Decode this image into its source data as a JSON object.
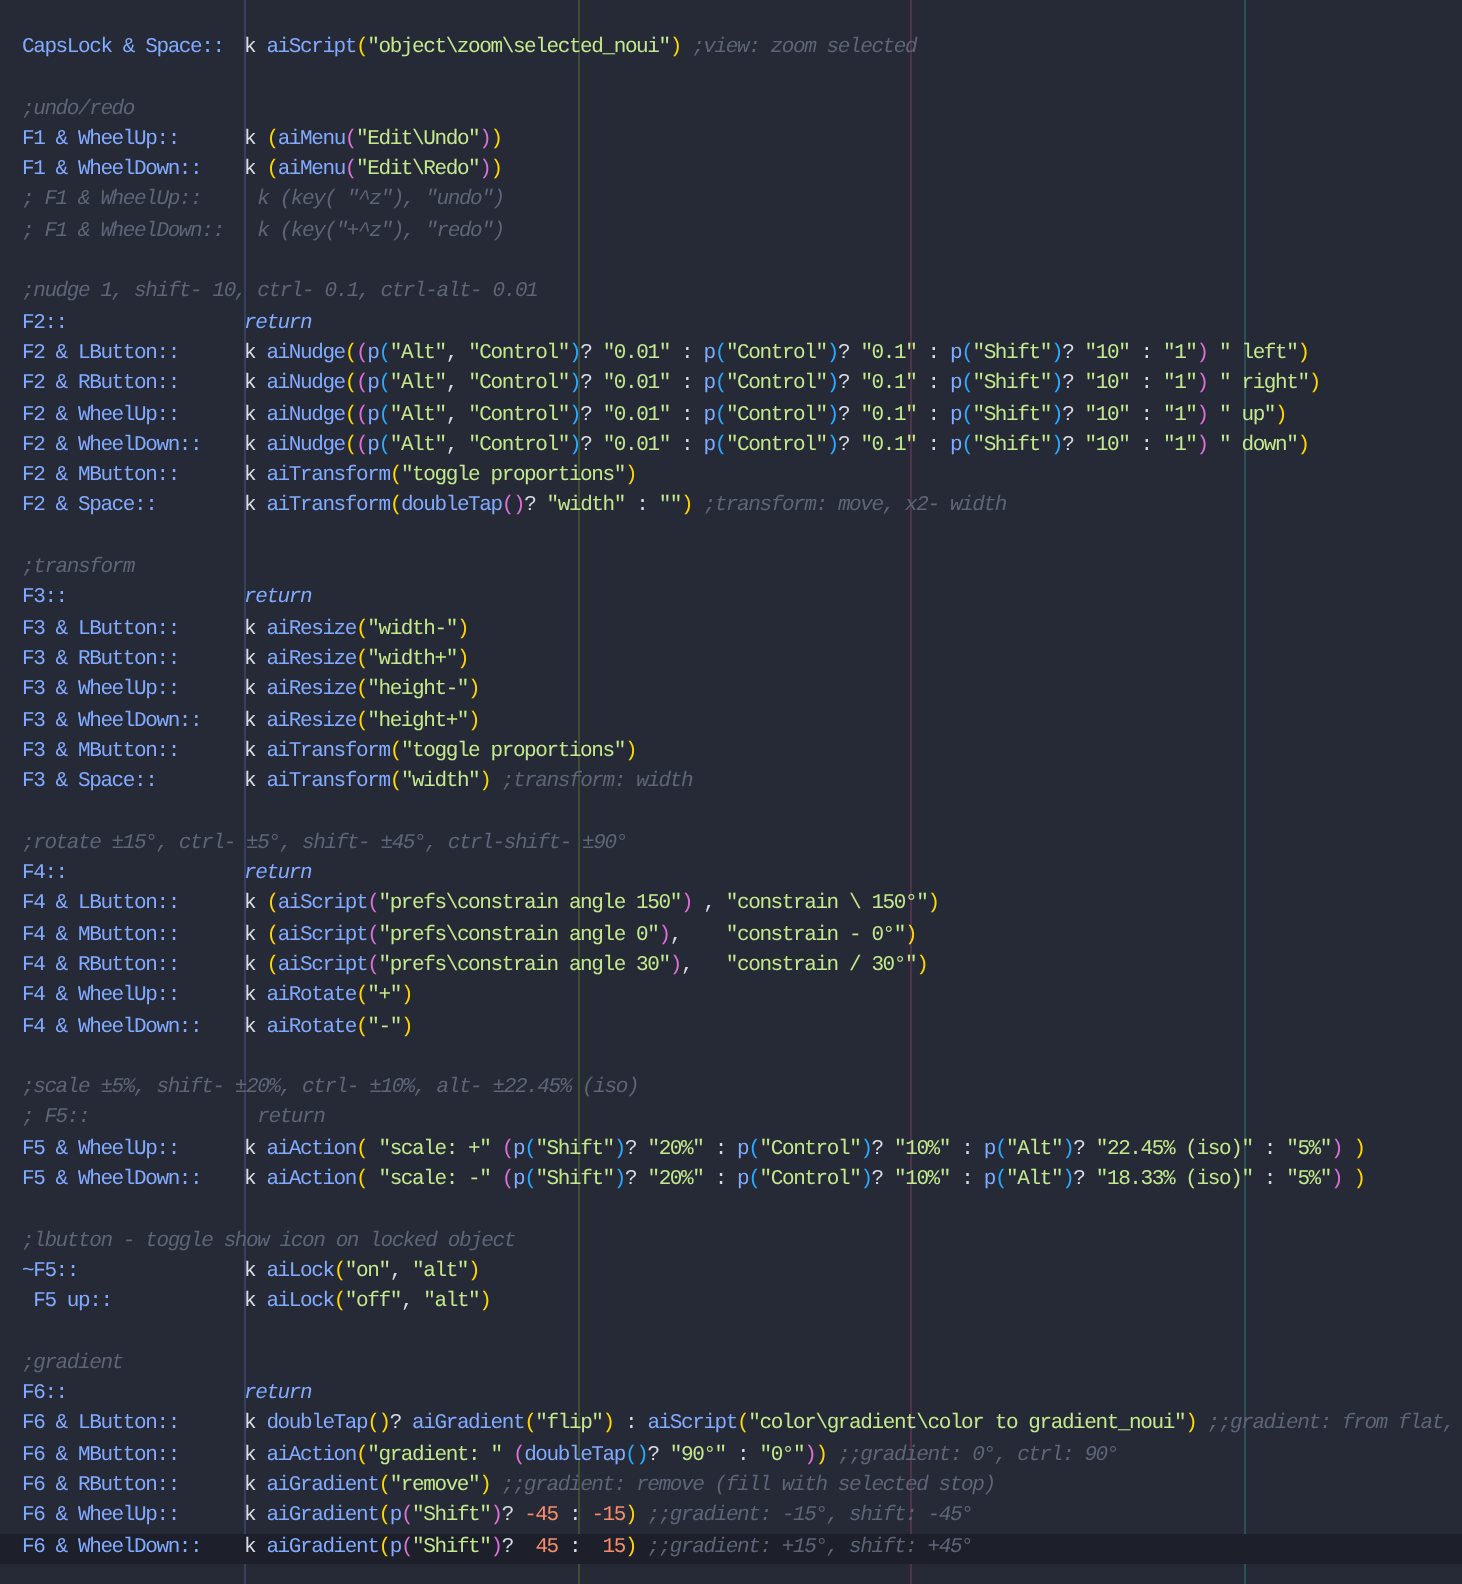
{
  "editor": {
    "lines": [
      {
        "kind": "binding",
        "hotkey": "CapsLock & Space::",
        "code": "k aiScript(\"object\\zoom\\selected_noui\") ;view: zoom selected",
        "current": false
      },
      {
        "kind": "blank",
        "current": false
      },
      {
        "kind": "comment",
        "text": ";undo/redo",
        "current": false
      },
      {
        "kind": "binding",
        "hotkey": "F1 & WheelUp::",
        "code": "k (aiMenu(\"Edit\\Undo\"))",
        "current": false
      },
      {
        "kind": "binding",
        "hotkey": "F1 & WheelDown::",
        "code": "k (aiMenu(\"Edit\\Redo\"))",
        "current": false
      },
      {
        "kind": "comment",
        "text": "; F1 & WheelUp::     k (key( \"^z\"), \"undo\")",
        "current": false
      },
      {
        "kind": "comment",
        "text": "; F1 & WheelDown::   k (key(\"+^z\"), \"redo\")",
        "current": false
      },
      {
        "kind": "blank",
        "current": false
      },
      {
        "kind": "comment",
        "text": ";nudge 1, shift- 10, ctrl- 0.1, ctrl-alt- 0.01",
        "current": false
      },
      {
        "kind": "block",
        "hotkey": "F2::",
        "code": "return",
        "current": false
      },
      {
        "kind": "binding",
        "hotkey": "F2 & LButton::",
        "code": "k aiNudge((p(\"Alt\", \"Control\")? \"0.01\" : p(\"Control\")? \"0.1\" : p(\"Shift\")? \"10\" : \"1\") \" left\")",
        "current": false
      },
      {
        "kind": "binding",
        "hotkey": "F2 & RButton::",
        "code": "k aiNudge((p(\"Alt\", \"Control\")? \"0.01\" : p(\"Control\")? \"0.1\" : p(\"Shift\")? \"10\" : \"1\") \" right\")",
        "current": false
      },
      {
        "kind": "binding",
        "hotkey": "F2 & WheelUp::",
        "code": "k aiNudge((p(\"Alt\", \"Control\")? \"0.01\" : p(\"Control\")? \"0.1\" : p(\"Shift\")? \"10\" : \"1\") \" up\")",
        "current": false
      },
      {
        "kind": "binding",
        "hotkey": "F2 & WheelDown::",
        "code": "k aiNudge((p(\"Alt\", \"Control\")? \"0.01\" : p(\"Control\")? \"0.1\" : p(\"Shift\")? \"10\" : \"1\") \" down\")",
        "current": false
      },
      {
        "kind": "binding",
        "hotkey": "F2 & MButton::",
        "code": "k aiTransform(\"toggle proportions\")",
        "current": false
      },
      {
        "kind": "binding",
        "hotkey": "F2 & Space::",
        "code": "k aiTransform(doubleTap()? \"width\" : \"\") ;transform: move, x2- width",
        "current": false
      },
      {
        "kind": "blank",
        "current": false
      },
      {
        "kind": "comment",
        "text": ";transform",
        "current": false
      },
      {
        "kind": "block",
        "hotkey": "F3::",
        "code": "return",
        "current": false
      },
      {
        "kind": "binding",
        "hotkey": "F3 & LButton::",
        "code": "k aiResize(\"width-\")",
        "current": false
      },
      {
        "kind": "binding",
        "hotkey": "F3 & RButton::",
        "code": "k aiResize(\"width+\")",
        "current": false
      },
      {
        "kind": "binding",
        "hotkey": "F3 & WheelUp::",
        "code": "k aiResize(\"height-\")",
        "current": false
      },
      {
        "kind": "binding",
        "hotkey": "F3 & WheelDown::",
        "code": "k aiResize(\"height+\")",
        "current": false
      },
      {
        "kind": "binding",
        "hotkey": "F3 & MButton::",
        "code": "k aiTransform(\"toggle proportions\")",
        "current": false
      },
      {
        "kind": "binding",
        "hotkey": "F3 & Space::",
        "code": "k aiTransform(\"width\") ;transform: width",
        "current": false
      },
      {
        "kind": "blank",
        "current": false
      },
      {
        "kind": "comment",
        "text": ";rotate ±15°, ctrl- ±5°, shift- ±45°, ctrl-shift- ±90°",
        "current": false
      },
      {
        "kind": "block",
        "hotkey": "F4::",
        "code": "return",
        "current": false
      },
      {
        "kind": "binding",
        "hotkey": "F4 & LButton::",
        "code": "k (aiScript(\"prefs\\constrain angle 150\") , \"constrain \\ 150°\")",
        "current": false
      },
      {
        "kind": "binding",
        "hotkey": "F4 & MButton::",
        "code": "k (aiScript(\"prefs\\constrain angle 0\"),    \"constrain - 0°\")",
        "current": false
      },
      {
        "kind": "binding",
        "hotkey": "F4 & RButton::",
        "code": "k (aiScript(\"prefs\\constrain angle 30\"),   \"constrain / 30°\")",
        "current": false
      },
      {
        "kind": "binding",
        "hotkey": "F4 & WheelUp::",
        "code": "k aiRotate(\"+\")",
        "current": false
      },
      {
        "kind": "binding",
        "hotkey": "F4 & WheelDown::",
        "code": "k aiRotate(\"-\")",
        "current": false
      },
      {
        "kind": "blank",
        "current": false
      },
      {
        "kind": "comment",
        "text": ";scale ±5%, shift- ±20%, ctrl- ±10%, alt- ±22.45% (iso)",
        "current": false
      },
      {
        "kind": "comment",
        "text": "; F5::               return",
        "current": false
      },
      {
        "kind": "binding",
        "hotkey": "F5 & WheelUp::",
        "code": "k aiAction( \"scale: +\" (p(\"Shift\")? \"20%\" : p(\"Control\")? \"10%\" : p(\"Alt\")? \"22.45% (iso)\" : \"5%\") )",
        "current": false
      },
      {
        "kind": "binding",
        "hotkey": "F5 & WheelDown::",
        "code": "k aiAction( \"scale: -\" (p(\"Shift\")? \"20%\" : p(\"Control\")? \"10%\" : p(\"Alt\")? \"18.33% (iso)\" : \"5%\") )",
        "current": false
      },
      {
        "kind": "blank",
        "current": false
      },
      {
        "kind": "comment",
        "text": ";lbutton - toggle show icon on locked object",
        "current": false
      },
      {
        "kind": "binding",
        "hotkey": "~F5::",
        "code": "k aiLock(\"on\", \"alt\")",
        "current": false
      },
      {
        "kind": "binding",
        "hotkey": " F5 up::",
        "code": "k aiLock(\"off\", \"alt\")",
        "current": false
      },
      {
        "kind": "blank",
        "current": false
      },
      {
        "kind": "comment",
        "text": ";gradient",
        "current": false
      },
      {
        "kind": "block",
        "hotkey": "F6::",
        "code": "return",
        "current": false
      },
      {
        "kind": "binding",
        "hotkey": "F6 & LButton::",
        "code": "k doubleTap()? aiGradient(\"flip\") : aiScript(\"color\\gradient\\color to gradient_noui\") ;;gradient: from flat,",
        "current": false
      },
      {
        "kind": "binding",
        "hotkey": "F6 & MButton::",
        "code": "k aiAction(\"gradient: \" (doubleTap()? \"90°\" : \"0°\")) ;;gradient: 0°, ctrl: 90°",
        "current": false
      },
      {
        "kind": "binding",
        "hotkey": "F6 & RButton::",
        "code": "k aiGradient(\"remove\") ;;gradient: remove (fill with selected stop)",
        "current": false
      },
      {
        "kind": "binding",
        "hotkey": "F6 & WheelUp::",
        "code": "k aiGradient(p(\"Shift\")? -45 : -15) ;;gradient: -15°, shift: -45°",
        "current": false
      },
      {
        "kind": "binding",
        "hotkey": "F6 & WheelDown::",
        "code": "k aiGradient(p(\"Shift\")?  45 :  15) ;;gradient: +15°, shift: +45°",
        "current": true
      }
    ]
  }
}
